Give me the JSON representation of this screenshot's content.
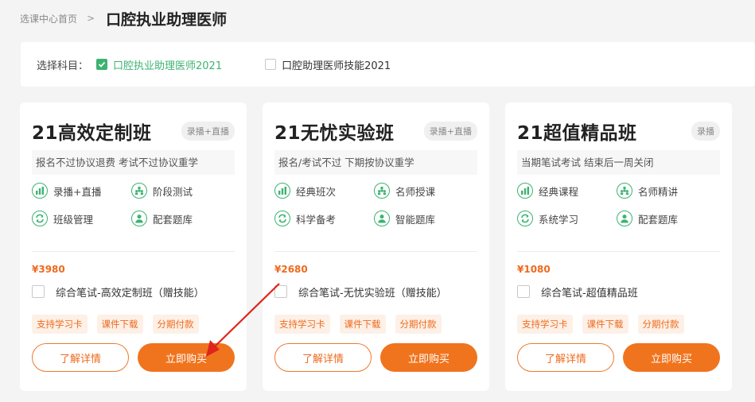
{
  "breadcrumb": {
    "home": "选课中心首页",
    "separator": ">",
    "current": "口腔执业助理医师"
  },
  "subject": {
    "label": "选择科目：",
    "options": [
      {
        "label": "口腔执业助理医师2021",
        "checked": true
      },
      {
        "label": "口腔助理医师技能2021",
        "checked": false
      }
    ]
  },
  "colors": {
    "accent_green": "#3cb371",
    "accent_orange": "#f0741e",
    "annotation_red": "#e0241c"
  },
  "cards": [
    {
      "title": "21高效定制班",
      "tag": "录播+直播",
      "desc": "报名不过协议退费 考试不过协议重学",
      "features": [
        {
          "icon": "chart-icon",
          "label": "录播+直播"
        },
        {
          "icon": "group-icon",
          "label": "阶段测试"
        },
        {
          "icon": "refresh-icon",
          "label": "班级管理"
        },
        {
          "icon": "person-icon",
          "label": "配套题库"
        }
      ],
      "price": "¥3980",
      "addon": "综合笔试-高效定制班（赠技能）",
      "badges": [
        "支持学习卡",
        "课件下载",
        "分期付款"
      ],
      "detail_label": "了解详情",
      "buy_label": "立即购买"
    },
    {
      "title": "21无忧实验班",
      "tag": "录播+直播",
      "desc": "报名/考试不过 下期按协议重学",
      "features": [
        {
          "icon": "chart-icon",
          "label": "经典班次"
        },
        {
          "icon": "group-icon",
          "label": "名师授课"
        },
        {
          "icon": "refresh-icon",
          "label": "科学备考"
        },
        {
          "icon": "person-icon",
          "label": "智能题库"
        }
      ],
      "price": "¥2680",
      "addon": "综合笔试-无忧实验班（赠技能）",
      "badges": [
        "支持学习卡",
        "课件下载",
        "分期付款"
      ],
      "detail_label": "了解详情",
      "buy_label": "立即购买"
    },
    {
      "title": "21超值精品班",
      "tag": "录播",
      "desc": "当期笔试考试 结束后一周关闭",
      "features": [
        {
          "icon": "chart-icon",
          "label": "经典课程"
        },
        {
          "icon": "group-icon",
          "label": "名师精讲"
        },
        {
          "icon": "refresh-icon",
          "label": "系统学习"
        },
        {
          "icon": "person-icon",
          "label": "配套题库"
        }
      ],
      "price": "¥1080",
      "addon": "综合笔试-超值精品班",
      "badges": [
        "支持学习卡",
        "课件下载",
        "分期付款"
      ],
      "detail_label": "了解详情",
      "buy_label": "立即购买"
    }
  ]
}
